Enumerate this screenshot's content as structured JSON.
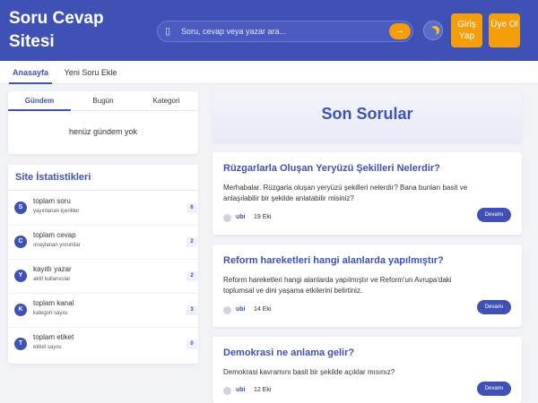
{
  "header": {
    "site_title": "Soru Cevap Sitesi",
    "search_placeholder": "Soru, cevap veya yazar ara...",
    "search_go": "→",
    "login_label": "Giriş Yap",
    "register_label": "Üye Ol",
    "colors": {
      "primary": "#3f51b5",
      "accent": "#f59e0b"
    }
  },
  "nav": {
    "tabs": [
      {
        "label": "Anasayfa",
        "active": true
      },
      {
        "label": "Yeni Soru Ekle",
        "active": false
      }
    ]
  },
  "agenda": {
    "tabs": [
      {
        "label": "Gündem",
        "active": true
      },
      {
        "label": "Bugün",
        "active": false
      },
      {
        "label": "Kategori",
        "active": false
      }
    ],
    "empty_text": "henüz gündem yok"
  },
  "stats": {
    "title": "Site İstatistikleri",
    "items": [
      {
        "letter": "S",
        "label": "toplam soru",
        "sub": "yayınlanan içerikler",
        "count": "6"
      },
      {
        "letter": "C",
        "label": "toplam cevap",
        "sub": "onaylanan yorumlar",
        "count": "2"
      },
      {
        "letter": "Y",
        "label": "kayıtlı yazar",
        "sub": "aktif kullanıcılar",
        "count": "2"
      },
      {
        "letter": "K",
        "label": "toplam kanal",
        "sub": "kategori sayısı",
        "count": "3"
      },
      {
        "letter": "T",
        "label": "toplam etiket",
        "sub": "etiket sayısı",
        "count": "0"
      }
    ]
  },
  "main": {
    "recent_title": "Son Sorular",
    "questions": [
      {
        "title": "Rüzgarlarla Oluşan Yeryüzü Şekilleri Nelerdir?",
        "excerpt": "Merhabalar. Rüzgarla oluşan yeryüzü şekilleri nelerdir? Bana bunları basit ve anlaşılabilir bir şekilde anlatabilir misiniz?",
        "author": "ubi",
        "date": "19 Eki",
        "more_label": "Devamı"
      },
      {
        "title": "Reform hareketleri hangi alanlarda yapılmıştır?",
        "excerpt": "Reform hareketleri hangi alanlarda yapılmıştır ve Reform'un Avrupa'daki toplumsal ve dini yaşama etkilerini belirtiniz.",
        "author": "ubi",
        "date": "14 Eki",
        "more_label": "Devamı"
      },
      {
        "title": "Demokrasi ne anlama gelir?",
        "excerpt": "Demokrasi kavramını basit bir şekilde açıklar mısınız?",
        "author": "ubi",
        "date": "12 Eki",
        "more_label": "Devamı"
      }
    ]
  }
}
